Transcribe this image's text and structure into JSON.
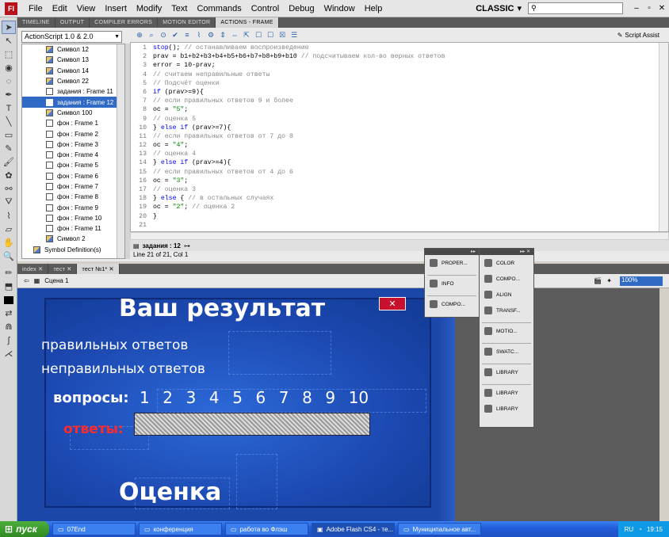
{
  "menubar": {
    "logo": "Fl",
    "items": [
      "File",
      "Edit",
      "View",
      "Insert",
      "Modify",
      "Text",
      "Commands",
      "Control",
      "Debug",
      "Window",
      "Help"
    ],
    "workspace": "CLASSIC",
    "search_placeholder": "",
    "window_buttons": [
      "–",
      "▫",
      "✕"
    ]
  },
  "panel_tabs": [
    "TIMELINE",
    "OUTPUT",
    "COMPILER ERRORS",
    "MOTION EDITOR",
    "ACTIONS - FRAME"
  ],
  "actions": {
    "version": "ActionScript 1.0 & 2.0",
    "script_assist": "Script Assist",
    "tree": [
      {
        "label": "Символ 12",
        "type": "sym"
      },
      {
        "label": "Символ 13",
        "type": "sym"
      },
      {
        "label": "Символ 14",
        "type": "sym"
      },
      {
        "label": "Символ 22",
        "type": "sym"
      },
      {
        "label": "задания : Frame 11",
        "type": "frame"
      },
      {
        "label": "задания : Frame 12",
        "type": "frame",
        "selected": true
      },
      {
        "label": "Символ 100",
        "type": "sym"
      },
      {
        "label": "фон : Frame 1",
        "type": "frame"
      },
      {
        "label": "фон : Frame 2",
        "type": "frame"
      },
      {
        "label": "фон : Frame 3",
        "type": "frame"
      },
      {
        "label": "фон : Frame 4",
        "type": "frame"
      },
      {
        "label": "фон : Frame 5",
        "type": "frame"
      },
      {
        "label": "фон : Frame 6",
        "type": "frame"
      },
      {
        "label": "фон : Frame 7",
        "type": "frame"
      },
      {
        "label": "фон : Frame 8",
        "type": "frame"
      },
      {
        "label": "фон : Frame 9",
        "type": "frame"
      },
      {
        "label": "фон : Frame 10",
        "type": "frame"
      },
      {
        "label": "фон : Frame 11",
        "type": "frame"
      },
      {
        "label": "Символ 2",
        "type": "sym"
      },
      {
        "label": "Symbol Definition(s)",
        "type": "sym"
      }
    ],
    "code": [
      [
        [
          "kw",
          "stop"
        ],
        [
          "",
          "(); "
        ],
        [
          "cm",
          "// останавливаем воспроизведение"
        ]
      ],
      [
        [
          "",
          "prav = b1+b2+b3+b4+b5+b6+b7+b8+b9+b10 "
        ],
        [
          "cm",
          "// подсчитываем кол-во верных ответов"
        ]
      ],
      [
        [
          "",
          "error = 10-prav;"
        ]
      ],
      [
        [
          "cm",
          "// считаем неправильные ответы"
        ]
      ],
      [
        [
          "cm",
          "// Подсчёт оценки"
        ]
      ],
      [
        [
          "kw",
          "if"
        ],
        [
          "",
          " (prav>=9){"
        ]
      ],
      [
        [
          "cm",
          "// если правильных ответов 9 и более"
        ]
      ],
      [
        [
          "",
          "oc = "
        ],
        [
          "st",
          "\"5\""
        ],
        [
          "",
          ";"
        ]
      ],
      [
        [
          "cm",
          "// оценка 5"
        ]
      ],
      [
        [
          "",
          "} "
        ],
        [
          "kw",
          "else if"
        ],
        [
          "",
          " (prav>=7){"
        ]
      ],
      [
        [
          "cm",
          "// если правильных ответов от 7 до 8"
        ]
      ],
      [
        [
          "",
          "oc = "
        ],
        [
          "st",
          "\"4\""
        ],
        [
          "",
          ";"
        ]
      ],
      [
        [
          "cm",
          "// оценка 4"
        ]
      ],
      [
        [
          "",
          "} "
        ],
        [
          "kw",
          "else if"
        ],
        [
          "",
          " (prav>=4){"
        ]
      ],
      [
        [
          "cm",
          "// если правильных ответов от 4 до 6"
        ]
      ],
      [
        [
          "",
          "oc = "
        ],
        [
          "st",
          "\"3\""
        ],
        [
          "",
          ";"
        ]
      ],
      [
        [
          "cm",
          "// оценка 3"
        ]
      ],
      [
        [
          "",
          "} "
        ],
        [
          "kw",
          "else"
        ],
        [
          "",
          " { "
        ],
        [
          "cm",
          "// в остальных случаях"
        ]
      ],
      [
        [
          "",
          "oc = "
        ],
        [
          "st",
          "\"2\""
        ],
        [
          "",
          "; "
        ],
        [
          "cm",
          "// оценка 2"
        ]
      ],
      [
        [
          "",
          "}"
        ]
      ],
      [
        [
          "",
          ""
        ]
      ]
    ],
    "script_tab": "задания : 12",
    "status": "Line 21 of 21, Col 1"
  },
  "doc_tabs": [
    "index",
    "тест",
    "тест №1*"
  ],
  "edit_bar": {
    "scene": "Сцена 1",
    "zoom": "100%"
  },
  "stage": {
    "title": "Ваш результат",
    "correct": "правильных ответов",
    "wrong": "неправильных ответов",
    "questions_label": "вопросы:",
    "questions": [
      "1",
      "2",
      "3",
      "4",
      "5",
      "6",
      "7",
      "8",
      "9",
      "10"
    ],
    "answers_label": "ответы:",
    "grade_label": "Оценка"
  },
  "float_left": [
    "PROPER...",
    "INFO",
    "COMPO..."
  ],
  "float_right": [
    [
      "COLOR",
      "COMPO...",
      "ALIGN",
      "TRANSF..."
    ],
    [
      "MOTIO..."
    ],
    [
      "SWATC..."
    ],
    [
      "LIBRARY"
    ],
    [
      "LIBRARY",
      "LIBRARY"
    ]
  ],
  "taskbar": {
    "start": "пуск",
    "tasks": [
      "07End",
      "конференция",
      "работа во Флэш",
      "Adobe Flash CS4 - те...",
      "Муниципальное авт..."
    ],
    "lang": "RU",
    "clock": "19:15"
  }
}
